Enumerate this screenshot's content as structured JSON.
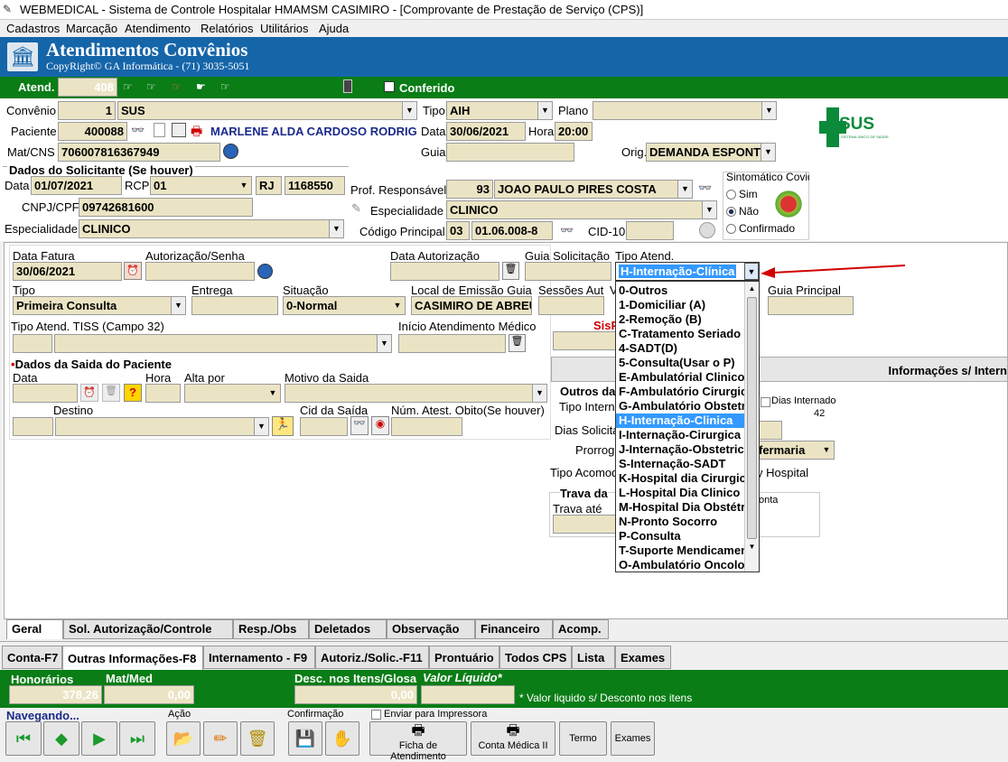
{
  "window": {
    "title": "WEBMEDICAL - Sistema de Controle Hospitalar HMAMSM CASIMIRO - [Comprovante de Prestação de Serviço (CPS)]"
  },
  "menu": [
    "Cadastros",
    "Marcação",
    "Atendimento",
    "Relatórios",
    "Utilitários",
    "Ajuda"
  ],
  "header": {
    "title": "Atendimentos Convênios",
    "subtitle": "CopyRight© GA Informática - (71) 3035-5051"
  },
  "atend": {
    "label": "Atend.",
    "value": "408",
    "conferido": "Conferido"
  },
  "patient": {
    "convenio_label": "Convênio",
    "convenio_code": "1",
    "convenio_name": "SUS",
    "tipo_label": "Tipo",
    "tipo": "AIH",
    "plano_label": "Plano",
    "paciente_label": "Paciente",
    "paciente_code": "400088",
    "paciente_name": "MARLENE ALDA CARDOSO RODRIGU",
    "data_label": "Data",
    "data": "30/06/2021",
    "hora_label": "Hora",
    "hora": "20:00",
    "matcns_label": "Mat/CNS",
    "matcns": "706007816367949",
    "guia_label": "Guia",
    "orig_label": "Orig.",
    "orig": "DEMANDA ESPONT"
  },
  "logo": {
    "text": "SUS",
    "sub": "SISTEMA ÚNICO DE SAÚDE"
  },
  "solicitante": {
    "title": "Dados do Solicitante (Se houver)",
    "data_label": "Data",
    "data": "01/07/2021",
    "rcp_label": "RCP",
    "rcp": "01",
    "uf": "RJ",
    "num": "1168550",
    "cnpj_label": "CNPJ/CPF",
    "cnpj": "09742681600",
    "esp_label": "Especialidade",
    "esp": "CLINICO"
  },
  "prof": {
    "label": "Prof. Responsável",
    "code": "93",
    "name": "JOAO PAULO PIRES COSTA",
    "esp_label": "Especialidade",
    "esp": "CLINICO",
    "cod_label": "Código Principal",
    "cod1": "03",
    "cod2": "01.06.008-8",
    "cid_label": "CID-10"
  },
  "sintomatico": {
    "title": "Sintomático Covid",
    "options": [
      "Sim",
      "Não",
      "Confirmado"
    ],
    "selected": "Não"
  },
  "fatura": {
    "data_fatura_label": "Data Fatura",
    "data_fatura": "30/06/2021",
    "aut_label": "Autorização/Senha",
    "data_aut_label": "Data Autorização",
    "guia_sol_label": "Guia Solicitação",
    "tipo_atend_label": "Tipo Atend.",
    "tipo_atend": "H-Internação-Clínica",
    "tipo_label": "Tipo",
    "tipo": "Primeira Consulta",
    "entrega_label": "Entrega",
    "situacao_label": "Situação",
    "situacao": "0-Normal",
    "local_label": "Local de Emissão Guia",
    "local": "CASIMIRO DE ABREU",
    "sessoes_label": "Sessões Aut",
    "v_label": "V",
    "guia_principal_label": "Guia Principal",
    "tiss_label": "Tipo Atend. TISS (Campo 32)",
    "inicio_label": "Início Atendimento Médico",
    "sis": "SisP"
  },
  "saida": {
    "title": "Dados da Saida do Paciente",
    "data_label": "Data",
    "hora_label": "Hora",
    "alta_label": "Alta por",
    "motivo_label": "Motivo da Saida",
    "destino_label": "Destino",
    "cid_label": "Cid da Saída",
    "atest_label": "Núm. Atest. Obito(Se houver)"
  },
  "info": {
    "header": "Informações s/ Intern",
    "outros": "Outros da",
    "tipo_interna": "Tipo Interna",
    "dias_internado_label": "Dias Internado",
    "dias_internado": "42",
    "dias_solic": "Dias Solicita",
    "prorrog": "Prorroga",
    "enfermaria": "fermaria",
    "tipo_acom": "Tipo Acomod",
    "day_hospital": "y Hospital",
    "trava_title": "Trava da",
    "trava_ate": "Trava até",
    "conta": "onta"
  },
  "dropdown": {
    "items": [
      "0-Outros",
      "1-Domiciliar (A)",
      "2-Remoção (B)",
      "C-Tratamento Seriado",
      "4-SADT(D)",
      "5-Consulta(Usar o P)",
      "E-Ambulatórial Clinico",
      "F-Ambulatório Cirurgico",
      "G-Ambulatório Obstetrico",
      "H-Internação-Clinica",
      "I-Internação-Cirurgica",
      "J-Internação-Obstetrica",
      "S-Internação-SADT",
      "K-Hospital dia Cirurgico",
      "L-Hospital Dia Clinico",
      "M-Hospital Dia Obstétrico",
      "N-Pronto Socorro",
      "P-Consulta",
      "T-Suporte Mendicamento",
      "O-Ambulatório Oncologia"
    ],
    "selected": 9
  },
  "tabs1": [
    "Geral",
    "Sol. Autorização/Controle",
    "Resp./Obs",
    "Deletados",
    "Observação",
    "Financeiro",
    "Acomp."
  ],
  "tabs2": [
    "Conta-F7",
    "Outras Informações-F8",
    "Internamento - F9",
    "Autoriz./Solic.-F11",
    "Prontuário",
    "Todos CPS",
    "Lista",
    "Exames"
  ],
  "totals": {
    "honorarios_label": "Honorários",
    "honorarios": "378,26",
    "matmed_label": "Mat/Med",
    "matmed": "0,00",
    "desc_label": "Desc. nos Itens/Glosa",
    "desc": "0,00",
    "liquido_label": "Valor Líquido*",
    "note": "* Valor liquido s/ Desconto nos itens"
  },
  "bottom": {
    "nav": "Navegando...",
    "acao": "Ação",
    "confirmacao": "Confirmação",
    "enviar": "Enviar para Impressora",
    "ficha": "Ficha de Atendimento",
    "conta": "Conta Médica II",
    "termo": "Termo",
    "exames": "Exames"
  },
  "colors": {
    "green": "#0a7d16",
    "header_blue": "#1565a9",
    "field": "#ebe4c4",
    "select": "#3399ff"
  }
}
